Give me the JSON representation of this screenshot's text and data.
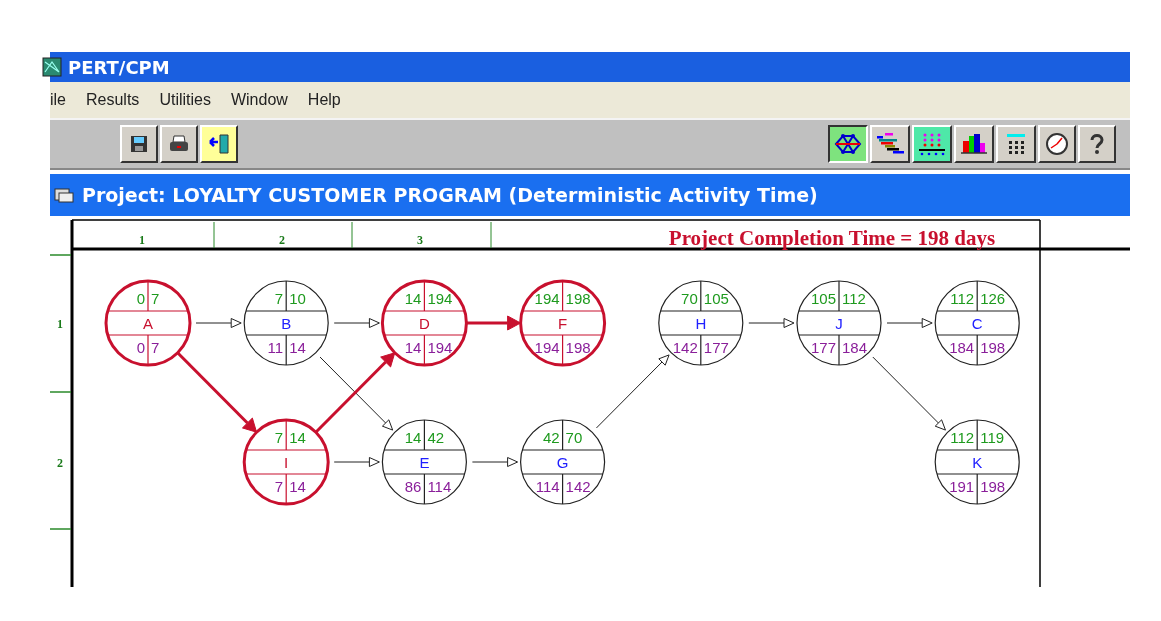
{
  "window": {
    "title": "PERT/CPM"
  },
  "menu": [
    "ile",
    "Results",
    "Utilities",
    "Window",
    "Help"
  ],
  "toolbar_left": [
    {
      "kind": "save",
      "selected": false
    },
    {
      "kind": "print",
      "selected": false
    },
    {
      "kind": "exit",
      "selected": false
    }
  ],
  "toolbar_right": [
    {
      "kind": "network",
      "selected": true
    },
    {
      "kind": "gantt",
      "selected": false
    },
    {
      "kind": "grid",
      "selected": false
    },
    {
      "kind": "bars",
      "selected": false
    },
    {
      "kind": "calculator",
      "selected": false
    },
    {
      "kind": "clock",
      "selected": false
    },
    {
      "kind": "help",
      "selected": false
    }
  ],
  "project_title": "Project: LOYALTY CUSTOMER PROGRAM (Deterministic Activity Time)",
  "columns": [
    "1",
    "2",
    "3"
  ],
  "rows": [
    "1",
    "2"
  ],
  "completion_text": "Project Completion Time = 198 days",
  "nodes": [
    {
      "name": "A",
      "es": "0",
      "ef": "7",
      "ls": "0",
      "lf": "7",
      "critical": true
    },
    {
      "name": "B",
      "es": "7",
      "ef": "10",
      "ls": "11",
      "lf": "14",
      "critical": false
    },
    {
      "name": "D",
      "es": "14",
      "ef": "194",
      "ls": "14",
      "lf": "194",
      "critical": true
    },
    {
      "name": "F",
      "es": "194",
      "ef": "198",
      "ls": "194",
      "lf": "198",
      "critical": true
    },
    {
      "name": "H",
      "es": "70",
      "ef": "105",
      "ls": "142",
      "lf": "177",
      "critical": false
    },
    {
      "name": "J",
      "es": "105",
      "ef": "112",
      "ls": "177",
      "lf": "184",
      "critical": false
    },
    {
      "name": "C",
      "es": "112",
      "ef": "126",
      "ls": "184",
      "lf": "198",
      "critical": false
    },
    {
      "name": "I",
      "es": "7",
      "ef": "14",
      "ls": "7",
      "lf": "14",
      "critical": true
    },
    {
      "name": "E",
      "es": "14",
      "ef": "42",
      "ls": "86",
      "lf": "114",
      "critical": false
    },
    {
      "name": "G",
      "es": "42",
      "ef": "70",
      "ls": "114",
      "lf": "142",
      "critical": false
    },
    {
      "name": "K",
      "es": "112",
      "ef": "119",
      "ls": "191",
      "lf": "198",
      "critical": false
    }
  ],
  "edges": [
    {
      "critical": false
    },
    {
      "critical": true
    },
    {
      "critical": false
    },
    {
      "critical": false
    },
    {
      "critical": true
    },
    {
      "critical": false
    },
    {
      "critical": true
    },
    {
      "critical": false
    },
    {
      "critical": false
    },
    {
      "critical": false
    },
    {
      "critical": false
    },
    {
      "critical": false
    }
  ]
}
